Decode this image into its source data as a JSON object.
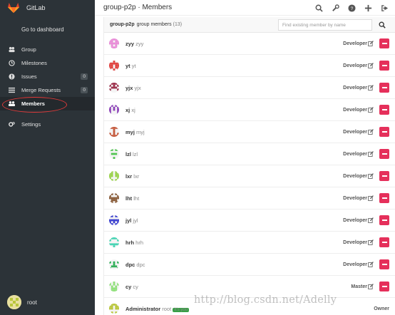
{
  "sidebar": {
    "brand": "GitLab",
    "dashboard_link": "Go to dashboard",
    "items": [
      {
        "label": "Group",
        "icon": "group-icon"
      },
      {
        "label": "Milestones",
        "icon": "clock-icon"
      },
      {
        "label": "Issues",
        "icon": "exclamation-icon",
        "count": "0"
      },
      {
        "label": "Merge Requests",
        "icon": "list-icon",
        "count": "0"
      },
      {
        "label": "Members",
        "icon": "users-icon",
        "active": true
      },
      {
        "label": "Settings",
        "icon": "cogs-icon"
      }
    ],
    "user": "root"
  },
  "header": {
    "title": "group-p2p · Members",
    "icons": [
      "search-icon",
      "wrench-icon",
      "help-icon",
      "plus-icon",
      "sign-out-icon"
    ]
  },
  "panel": {
    "group": "group-p2p",
    "label": "group members",
    "count": "(13)",
    "search_placeholder": "Find existing member by name"
  },
  "members": [
    {
      "name": "zyy",
      "username": "zyy",
      "role": "Developer",
      "color": "#e88cd7"
    },
    {
      "name": "yt",
      "username": "yt",
      "role": "Developer",
      "color": "#e0413e"
    },
    {
      "name": "yjx",
      "username": "yjx",
      "role": "Developer",
      "color": "#9c2f4a"
    },
    {
      "name": "xj",
      "username": "xj",
      "role": "Developer",
      "color": "#8b3fb8"
    },
    {
      "name": "myj",
      "username": "myj",
      "role": "Developer",
      "color": "#c4573a"
    },
    {
      "name": "lzl",
      "username": "lzl",
      "role": "Developer",
      "color": "#4ec44e"
    },
    {
      "name": "lxr",
      "username": "lxr",
      "role": "Developer",
      "color": "#9ad24a"
    },
    {
      "name": "lht",
      "username": "lht",
      "role": "Developer",
      "color": "#8a5d3a"
    },
    {
      "name": "jyl",
      "username": "jyl",
      "role": "Developer",
      "color": "#3a3fd0"
    },
    {
      "name": "hrh",
      "username": "hrh",
      "role": "Developer",
      "color": "#45d4b3"
    },
    {
      "name": "dpc",
      "username": "dpc",
      "role": "Developer",
      "color": "#2fae57"
    },
    {
      "name": "cy",
      "username": "cy",
      "role": "Master",
      "color": "#8fe07a"
    },
    {
      "name": "Administrator",
      "username": "root",
      "role": "Owner",
      "color": "#b9c63a",
      "you": "It's you"
    }
  ],
  "watermark": "http://blog.csdn.net/Adelly"
}
